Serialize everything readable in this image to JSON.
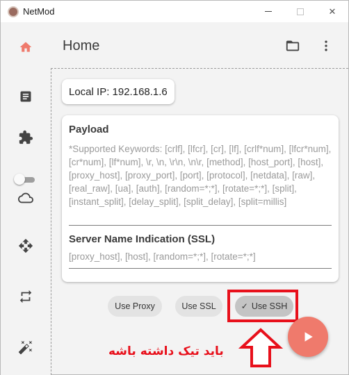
{
  "window": {
    "app_title": "NetMod",
    "controls": {
      "minimize": "minimize",
      "maximize": "maximize",
      "close": "✕"
    }
  },
  "rail": {
    "items": [
      {
        "id": "home",
        "icon": "home-icon",
        "active": true
      },
      {
        "id": "logs",
        "icon": "document-icon"
      },
      {
        "id": "plugins",
        "icon": "puzzle-icon"
      },
      {
        "id": "cloud",
        "icon": "cloud-icon"
      },
      {
        "id": "move",
        "icon": "move-arrows-icon"
      },
      {
        "id": "repeat",
        "icon": "repeat-icon"
      },
      {
        "id": "tools",
        "icon": "magic-wand-icon"
      }
    ],
    "toggle_on": false
  },
  "header": {
    "title": "Home",
    "folder_icon": "folder-icon",
    "menu_icon": "more-vert-icon"
  },
  "main": {
    "local_ip": "Local IP: 192.168.1.6",
    "payload": {
      "label": "Payload",
      "placeholder": "*Supported Keywords: [crlf], [lfcr], [cr], [lf], [crlf*num], [lfcr*num], [cr*num], [lf*num], \\r, \\n, \\r\\n, \\n\\r, [method], [host_port], [host], [proxy_host], [proxy_port], [port], [protocol], [netdata], [raw], [real_raw], [ua], [auth], [random=*;*], [rotate=*;*], [split], [instant_split], [delay_split], [split_delay], [split=millis]"
    },
    "sni": {
      "label": "Server Name Indication (SSL)",
      "placeholder": "[proxy_host], [host], [random=*;*], [rotate=*;*]"
    },
    "chips": {
      "use_proxy": "Use Proxy",
      "use_ssl": "Use SSL",
      "use_ssh": "Use SSH",
      "check_mark": "✓"
    },
    "start_button_icon": "play-icon"
  },
  "annotation": {
    "text": "باید تیک داشته باشه",
    "color": "#e8101b"
  },
  "colors": {
    "accent": "#ef7a6c",
    "annotation": "#e8101b",
    "background": "#f3f3f3"
  }
}
